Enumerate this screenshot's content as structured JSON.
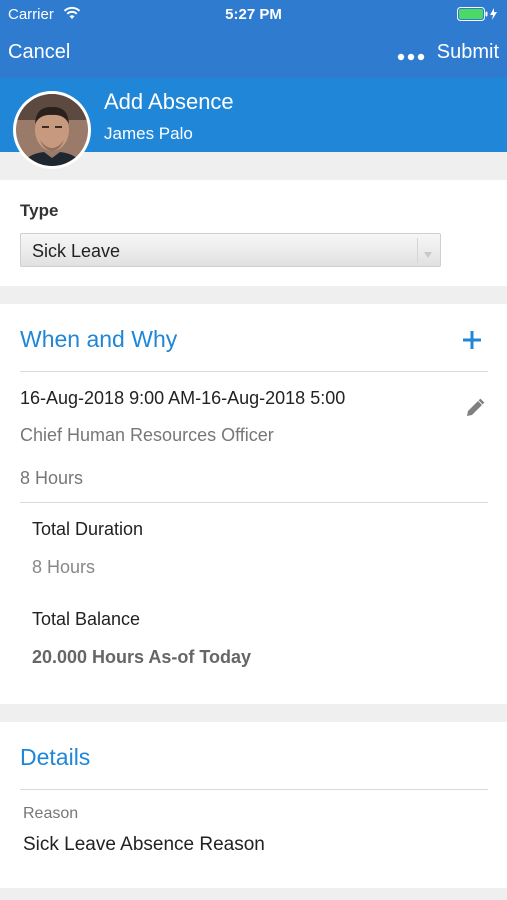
{
  "status_bar": {
    "carrier": "Carrier",
    "time": "5:27 PM"
  },
  "nav": {
    "cancel_label": "Cancel",
    "submit_label": "Submit"
  },
  "header": {
    "title": "Add Absence",
    "person_name": "James Palo"
  },
  "type_section": {
    "label": "Type",
    "selected_value": "Sick Leave"
  },
  "when_why": {
    "title": "When and Why",
    "entry": {
      "dates": "16-Aug-2018 9:00 AM-16-Aug-2018 5:00",
      "role": "Chief Human Resources Officer",
      "hours": "8 Hours"
    },
    "total_duration_label": "Total Duration",
    "total_duration_value": "8 Hours",
    "total_balance_label": "Total Balance",
    "total_balance_value": "20.000 Hours As-of Today"
  },
  "details": {
    "title": "Details",
    "reason_label": "Reason",
    "reason_value": "Sick Leave Absence Reason"
  },
  "colors": {
    "nav_bar": "#2e7bcf",
    "header_bar": "#1f86d8",
    "accent": "#1f86d8",
    "battery": "#4cd964"
  },
  "icons": [
    "wifi-icon",
    "battery-icon",
    "more-icon",
    "avatar",
    "dropdown-icon",
    "add-icon",
    "edit-icon"
  ]
}
